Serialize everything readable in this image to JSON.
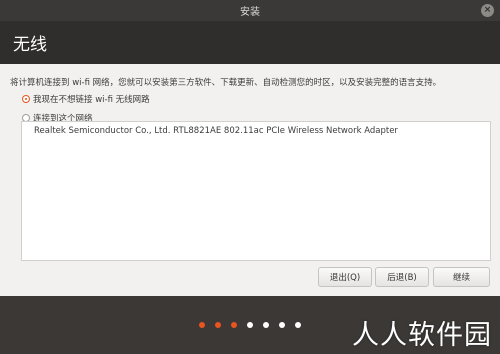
{
  "window": {
    "title": "安装",
    "close_glyph": "×"
  },
  "header": {
    "title": "无线"
  },
  "content": {
    "intro": "将计算机连接到 wi-fi 网络，您就可以安装第三方软件、下载更新、自动检测您的时区，以及安装完整的语言支持。",
    "option_no_connect": "我现在不想链接 wi-fi 无线网路",
    "option_connect": "连接到这个网络",
    "network_item": "Realtek Semiconductor Co., Ltd. RTL8821AE 802.11ac PCIe Wireless Network Adapter"
  },
  "buttons": {
    "quit": "退出(Q)",
    "back": "后退(B)",
    "continue": "继续"
  },
  "progress": {
    "total_steps": 7,
    "completed_steps": 3
  },
  "watermark": "人人软件园",
  "colors": {
    "accent": "#e95420",
    "dot_inactive": "#ffffff"
  }
}
